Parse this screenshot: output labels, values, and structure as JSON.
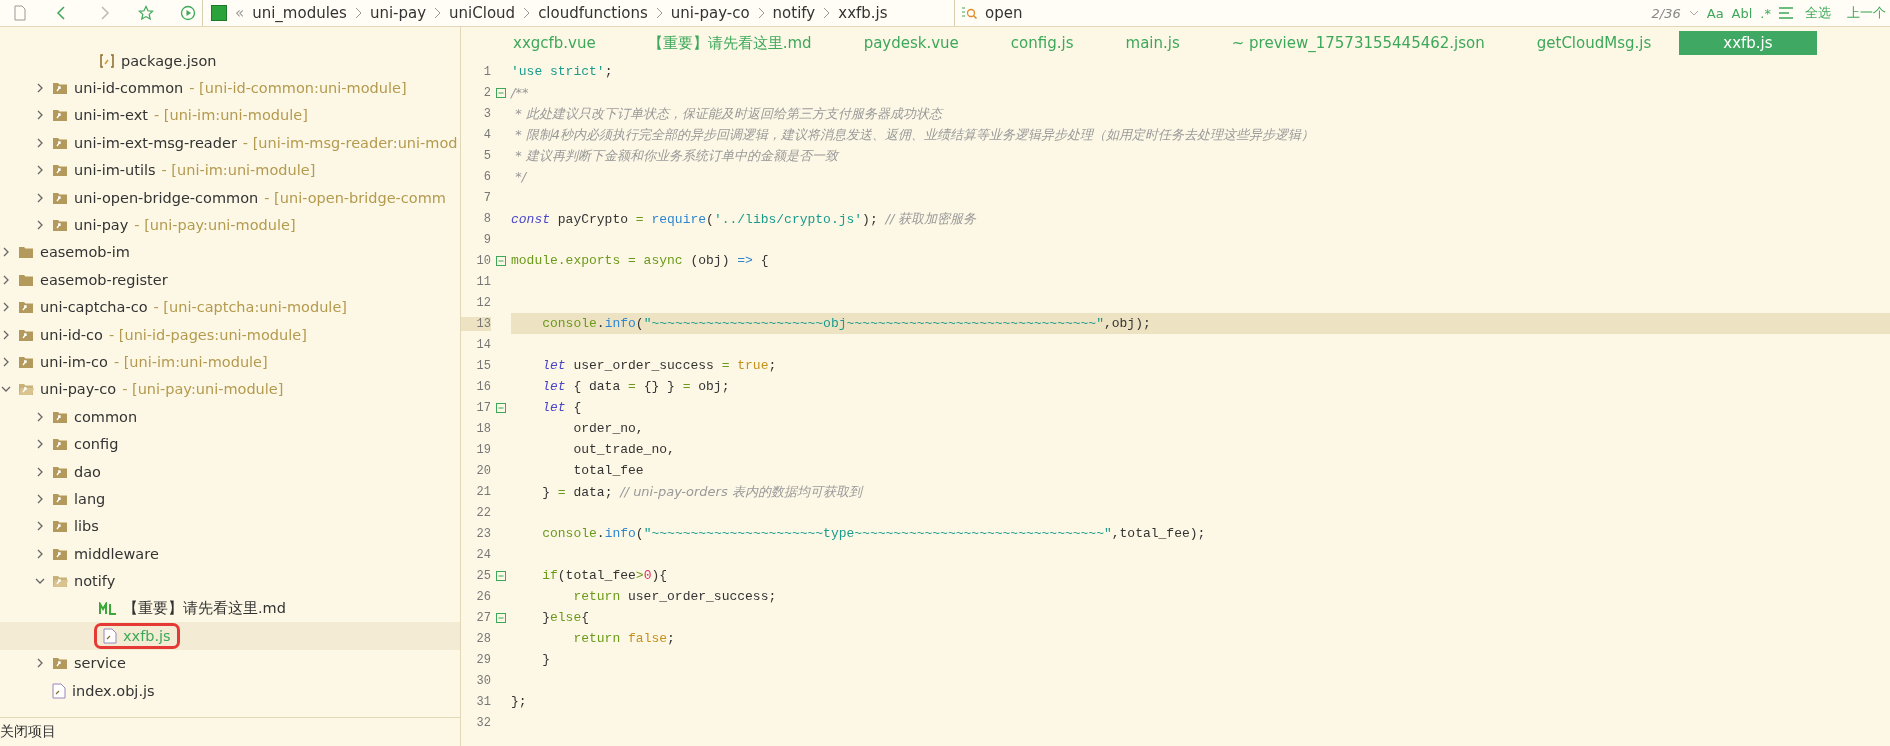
{
  "toolbar": {
    "breadcrumb": [
      "uni_modules",
      "uni-pay",
      "uniCloud",
      "cloudfunctions",
      "uni-pay-co",
      "notify",
      "xxfb.js"
    ],
    "breadcrumb_prefix": "«"
  },
  "search": {
    "value": "open",
    "match_count": "2/36",
    "options": [
      "Aa",
      "Abl",
      ".*"
    ],
    "buttons": [
      "全选",
      "上一个"
    ]
  },
  "sidebar": {
    "tree": [
      {
        "children": [
          {
            "children": [
              {
                "label": "package.json",
                "kind": "package"
              }
            ]
          },
          {
            "label": "uni-id-common",
            "tag": "- [uni-id-common:uni-module]",
            "kind": "module",
            "expanded": false
          },
          {
            "label": "uni-im-ext",
            "tag": "- [uni-im:uni-module]",
            "kind": "module",
            "expanded": false
          },
          {
            "label": "uni-im-ext-msg-reader",
            "tag": "- [uni-im-msg-reader:uni-mod",
            "kind": "module",
            "expanded": false
          },
          {
            "label": "uni-im-utils",
            "tag": "- [uni-im:uni-module]",
            "kind": "module",
            "expanded": false
          },
          {
            "label": "uni-open-bridge-common",
            "tag": "- [uni-open-bridge-comm",
            "kind": "module",
            "expanded": false
          },
          {
            "label": "uni-pay",
            "tag": "- [uni-pay:uni-module]",
            "kind": "module",
            "expanded": false
          }
        ]
      },
      {
        "label": "easemob-im",
        "kind": "folder",
        "expanded": false
      },
      {
        "label": "easemob-register",
        "kind": "folder",
        "expanded": false
      },
      {
        "label": "uni-captcha-co",
        "tag": "- [uni-captcha:uni-module]",
        "kind": "module",
        "expanded": false
      },
      {
        "label": "uni-id-co",
        "tag": "- [uni-id-pages:uni-module]",
        "kind": "module",
        "expanded": false
      },
      {
        "label": "uni-im-co",
        "tag": "- [uni-im:uni-module]",
        "kind": "module",
        "expanded": false
      },
      {
        "label": "uni-pay-co",
        "tag": "- [uni-pay:uni-module]",
        "kind": "module",
        "expanded": true,
        "children": [
          {
            "label": "common",
            "kind": "module",
            "expanded": false
          },
          {
            "label": "config",
            "kind": "module",
            "expanded": false
          },
          {
            "label": "dao",
            "kind": "module",
            "expanded": false
          },
          {
            "label": "lang",
            "kind": "module",
            "expanded": false
          },
          {
            "label": "libs",
            "kind": "module",
            "expanded": false
          },
          {
            "label": "middleware",
            "kind": "module",
            "expanded": false
          },
          {
            "label": "notify",
            "kind": "module",
            "expanded": true,
            "children": [
              {
                "label": "【重要】请先看这里.md",
                "kind": "md",
                "selected": false
              },
              {
                "label": "xxfb.js",
                "kind": "js",
                "selected": true,
                "boxed": true
              }
            ]
          },
          {
            "label": "service",
            "kind": "module",
            "expanded": false
          },
          {
            "label": "index.obj.js",
            "kind": "js",
            "selected": false
          }
        ]
      }
    ],
    "footer": "关闭项目"
  },
  "tabs": [
    {
      "label": "xxgcfb.vue",
      "selected": false
    },
    {
      "label": "【重要】请先看这里.md",
      "selected": false
    },
    {
      "label": "paydesk.vue",
      "selected": false
    },
    {
      "label": "config.js",
      "selected": false
    },
    {
      "label": "main.js",
      "selected": false
    },
    {
      "label": "~ preview_17573155445462.json",
      "selected": false
    },
    {
      "label": "getCloudMsg.js",
      "selected": false
    },
    {
      "label": "xxfb.js",
      "selected": true
    }
  ],
  "editor": {
    "lines": [
      {
        "number": "1",
        "tokens": [
          {
            "kind": "string",
            "text": "'use strict'"
          },
          {
            "kind": "plain",
            "text": ";"
          }
        ],
        "fold": false,
        "current": false
      },
      {
        "number": "2",
        "tokens": [
          {
            "kind": "comment",
            "text": "/**"
          }
        ],
        "fold": true,
        "current": false
      },
      {
        "number": "3",
        "tokens": [
          {
            "kind": "comment",
            "text": " * 此处建议只改下订单状态，保证能及时返回给第三方支付服务器成功状态"
          }
        ],
        "fold": false,
        "current": false
      },
      {
        "number": "4",
        "tokens": [
          {
            "kind": "comment",
            "text": " * 限制4秒内必须执行完全部的异步回调逻辑，建议将消息发送、返佣、业绩结算等业务逻辑异步处理（如用定时任务去处理这些异步逻辑）"
          }
        ],
        "fold": false,
        "current": false
      },
      {
        "number": "5",
        "tokens": [
          {
            "kind": "comment",
            "text": " * 建议再判断下金额和你业务系统订单中的金额是否一致"
          }
        ],
        "fold": false,
        "current": false
      },
      {
        "number": "6",
        "tokens": [
          {
            "kind": "comment",
            "text": " */"
          }
        ],
        "fold": false,
        "current": false
      },
      {
        "number": "7",
        "fold": false,
        "current": false
      },
      {
        "number": "8",
        "tokens": [
          {
            "kind": "keyword",
            "text": "const"
          },
          {
            "kind": "plain",
            "text": " payCrypto "
          },
          {
            "kind": "green",
            "text": "= "
          },
          {
            "kind": "func",
            "text": "require"
          },
          {
            "kind": "plain",
            "text": "("
          },
          {
            "kind": "string",
            "text": "'../libs/crypto.js'"
          },
          {
            "kind": "plain",
            "text": "); "
          },
          {
            "kind": "comment",
            "text": "// 获取加密服务"
          }
        ],
        "fold": false,
        "current": false
      },
      {
        "number": "9",
        "fold": false,
        "current": false
      },
      {
        "number": "10",
        "tokens": [
          {
            "kind": "green",
            "text": "module.exports = async"
          },
          {
            "kind": "plain",
            "text": " (obj) "
          },
          {
            "kind": "func",
            "text": "=>"
          },
          {
            "kind": "plain",
            "text": " {"
          }
        ],
        "fold": true,
        "current": false
      },
      {
        "number": "11",
        "fold": false,
        "current": false
      },
      {
        "number": "12",
        "fold": false,
        "current": false
      },
      {
        "number": "13",
        "tokens": [
          {
            "kind": "green",
            "text": "    console"
          },
          {
            "kind": "plain",
            "text": "."
          },
          {
            "kind": "func",
            "text": "info"
          },
          {
            "kind": "plain",
            "text": "("
          },
          {
            "kind": "string",
            "text": "\"~~~~~~~~~~~~~~~~~~~~~~obj~~~~~~~~~~~~~~~~~~~~~~~~~~~~~~~~\""
          },
          {
            "kind": "plain",
            "text": ",obj);"
          }
        ],
        "fold": false,
        "current": true
      },
      {
        "number": "14",
        "fold": false,
        "current": false
      },
      {
        "number": "15",
        "tokens": [
          {
            "kind": "keyword",
            "text": "    let"
          },
          {
            "kind": "plain",
            "text": " user_order_success "
          },
          {
            "kind": "green",
            "text": "= "
          },
          {
            "kind": "literal",
            "text": "true"
          },
          {
            "kind": "plain",
            "text": ";"
          }
        ],
        "fold": false,
        "current": false
      },
      {
        "number": "16",
        "tokens": [
          {
            "kind": "keyword",
            "text": "    let"
          },
          {
            "kind": "plain",
            "text": " { data "
          },
          {
            "kind": "green",
            "text": "="
          },
          {
            "kind": "plain",
            "text": " {} } "
          },
          {
            "kind": "green",
            "text": "="
          },
          {
            "kind": "plain",
            "text": " obj;"
          }
        ],
        "fold": false,
        "current": false
      },
      {
        "number": "17",
        "tokens": [
          {
            "kind": "keyword",
            "text": "    let"
          },
          {
            "kind": "plain",
            "text": " {"
          }
        ],
        "fold": true,
        "current": false
      },
      {
        "number": "18",
        "tokens": [
          {
            "kind": "plain",
            "text": "        order_no,"
          }
        ],
        "fold": false,
        "current": false
      },
      {
        "number": "19",
        "tokens": [
          {
            "kind": "plain",
            "text": "        out_trade_no,"
          }
        ],
        "fold": false,
        "current": false
      },
      {
        "number": "20",
        "tokens": [
          {
            "kind": "plain",
            "text": "        total_fee"
          }
        ],
        "fold": false,
        "current": false
      },
      {
        "number": "21",
        "tokens": [
          {
            "kind": "plain",
            "text": "    } "
          },
          {
            "kind": "green",
            "text": "="
          },
          {
            "kind": "plain",
            "text": " data; "
          },
          {
            "kind": "comment",
            "text": "// uni-pay-orders 表内的数据均可获取到"
          }
        ],
        "fold": false,
        "current": false
      },
      {
        "number": "22",
        "fold": false,
        "current": false
      },
      {
        "number": "23",
        "tokens": [
          {
            "kind": "green",
            "text": "    console"
          },
          {
            "kind": "plain",
            "text": "."
          },
          {
            "kind": "func",
            "text": "info"
          },
          {
            "kind": "plain",
            "text": "("
          },
          {
            "kind": "string",
            "text": "\"~~~~~~~~~~~~~~~~~~~~~~type~~~~~~~~~~~~~~~~~~~~~~~~~~~~~~~~\""
          },
          {
            "kind": "plain",
            "text": ",total_fee);"
          }
        ],
        "fold": false,
        "current": false
      },
      {
        "number": "24",
        "fold": false,
        "current": false
      },
      {
        "number": "25",
        "tokens": [
          {
            "kind": "green",
            "text": "    if"
          },
          {
            "kind": "plain",
            "text": "(total_fee"
          },
          {
            "kind": "green",
            "text": ">"
          },
          {
            "kind": "number",
            "text": "0"
          },
          {
            "kind": "plain",
            "text": "){"
          }
        ],
        "fold": true,
        "current": false
      },
      {
        "number": "26",
        "tokens": [
          {
            "kind": "green",
            "text": "        return"
          },
          {
            "kind": "plain",
            "text": " user_order_success;"
          }
        ],
        "fold": false,
        "current": false
      },
      {
        "number": "27",
        "tokens": [
          {
            "kind": "plain",
            "text": "    }"
          },
          {
            "kind": "green",
            "text": "else"
          },
          {
            "kind": "plain",
            "text": "{"
          }
        ],
        "fold": true,
        "current": false
      },
      {
        "number": "28",
        "tokens": [
          {
            "kind": "green",
            "text": "        return "
          },
          {
            "kind": "literal",
            "text": "false"
          },
          {
            "kind": "plain",
            "text": ";"
          }
        ],
        "fold": false,
        "current": false
      },
      {
        "number": "29",
        "tokens": [
          {
            "kind": "plain",
            "text": "    }"
          }
        ],
        "fold": false,
        "current": false
      },
      {
        "number": "30",
        "fold": false,
        "current": false
      },
      {
        "number": "31",
        "tokens": [
          {
            "kind": "plain",
            "text": "};"
          }
        ],
        "fold": false,
        "current": false
      },
      {
        "number": "32",
        "fold": false,
        "current": false
      }
    ]
  }
}
